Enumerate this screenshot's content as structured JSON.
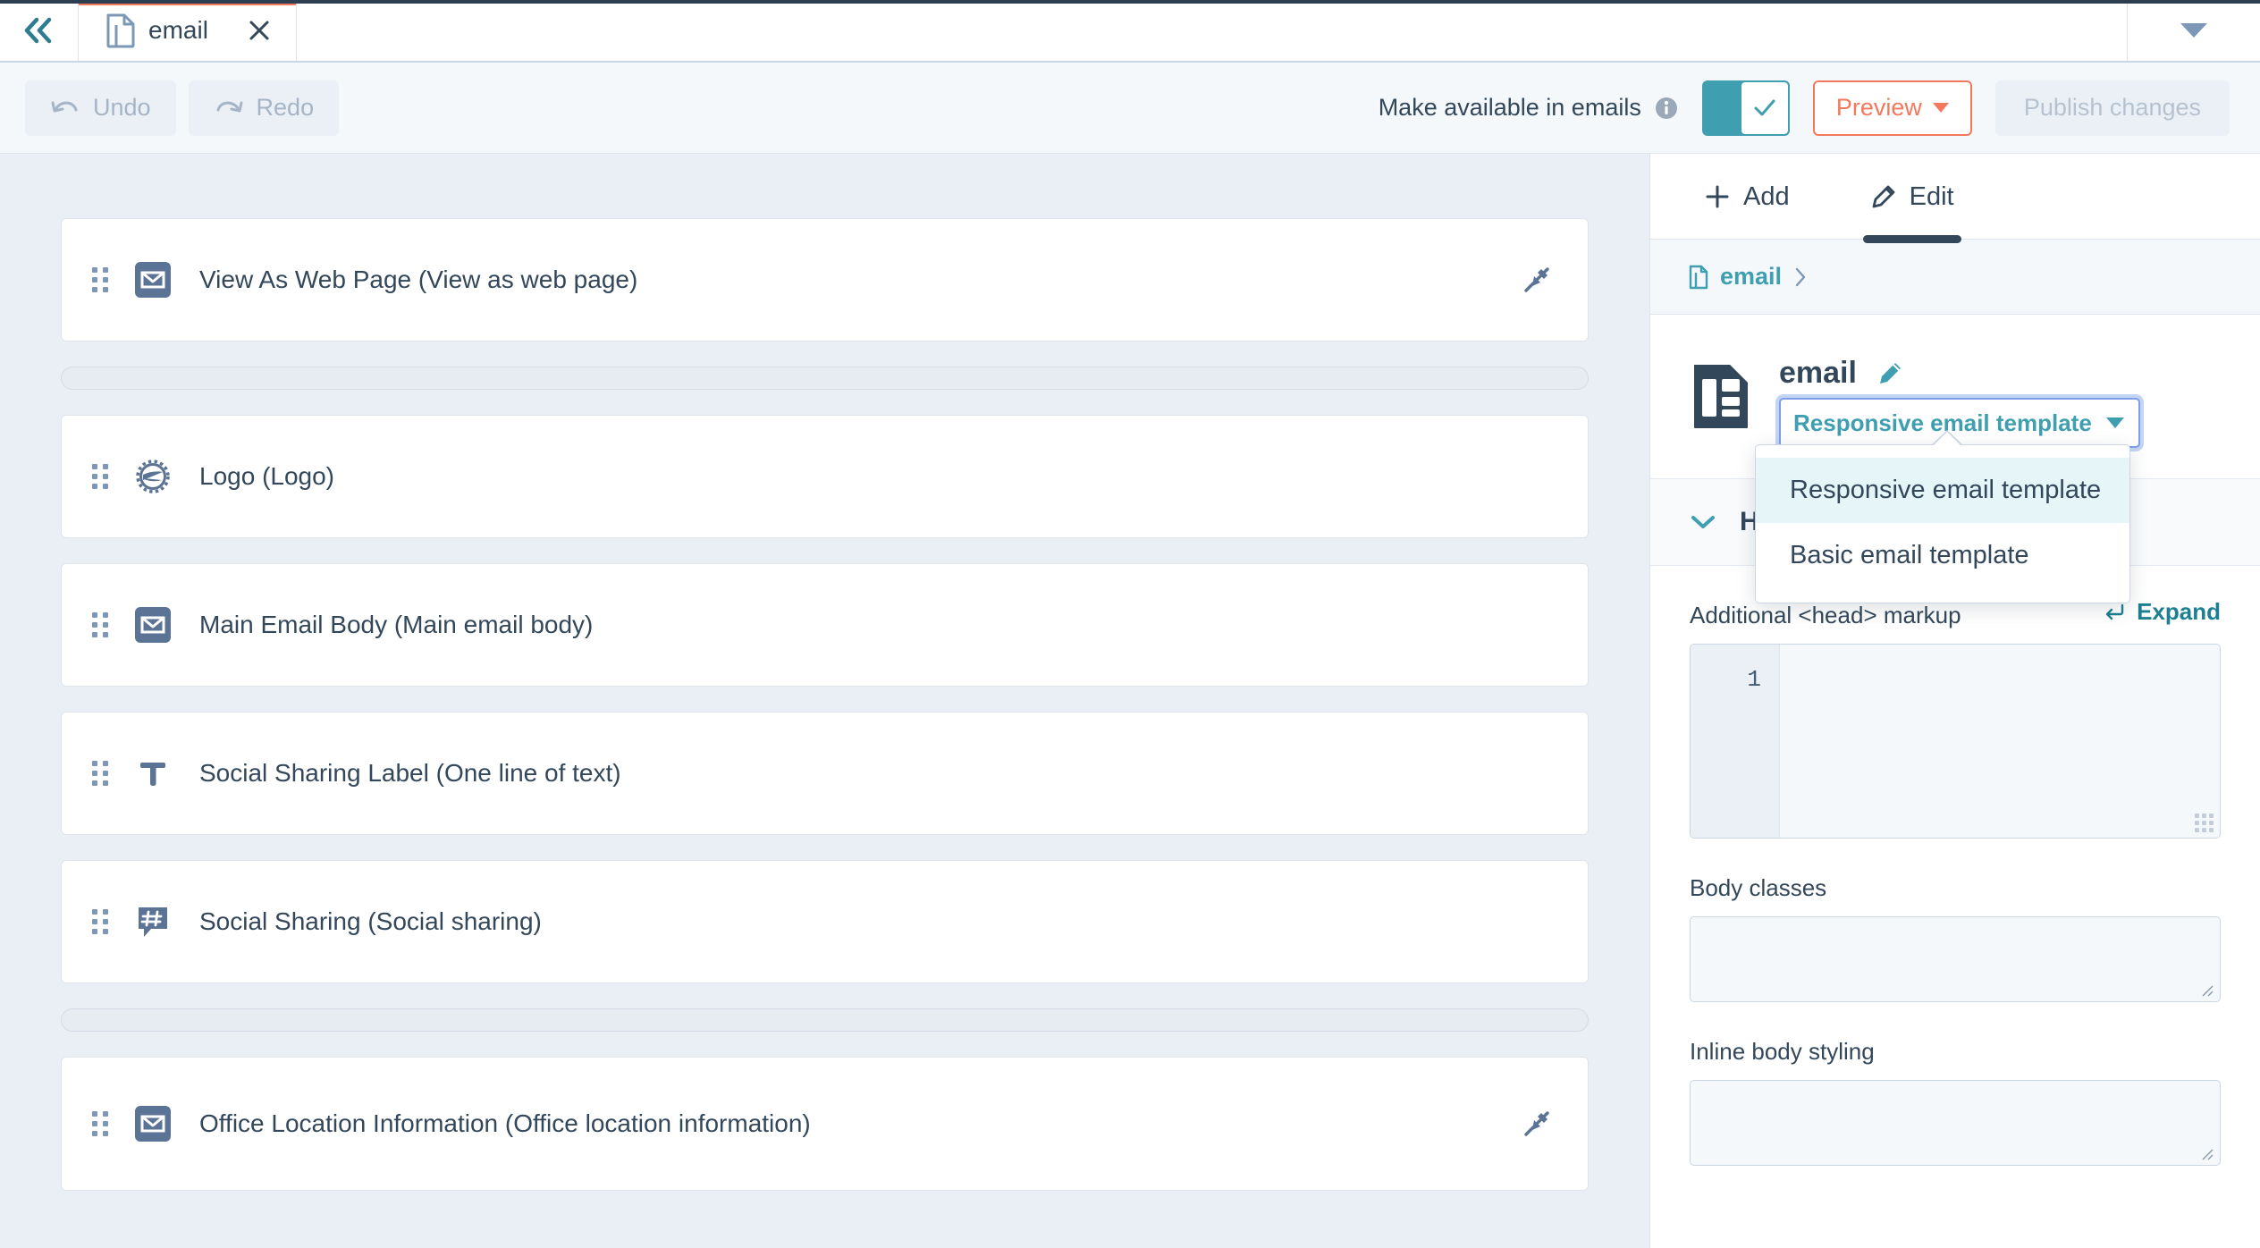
{
  "tabbar": {
    "collapse_label": "collapse-sidebar",
    "tab_title": "email",
    "tab_doc_icon": "document-icon",
    "close_icon": "close-icon",
    "overflow_caret_icon": "chevron-down-icon"
  },
  "toolbar": {
    "undo_label": "Undo",
    "redo_label": "Redo",
    "undo_icon": "undo-arrow-icon",
    "redo_icon": "redo-arrow-icon",
    "available_label": "Make available in emails",
    "info_icon": "info-circle-icon",
    "toggle_state": "on",
    "toggle_check_icon": "check-icon",
    "preview_label": "Preview",
    "publish_label": "Publish changes",
    "accent_orange": "#f2795c",
    "accent_teal": "#3f9fb0"
  },
  "canvas": {
    "modules": [
      {
        "label": "View As Web Page (View as web page)",
        "icon": "envelope-square-icon",
        "locked": true,
        "lock_icon": "pencil-slash-icon",
        "spacer_after": true
      },
      {
        "label": "Logo (Logo)",
        "icon": "logo-badge-icon",
        "locked": false,
        "spacer_after": false
      },
      {
        "label": "Main Email Body (Main email body)",
        "icon": "envelope-square-icon",
        "locked": false,
        "spacer_after": false
      },
      {
        "label": "Social Sharing Label (One line of text)",
        "icon": "text-t-icon",
        "locked": false,
        "spacer_after": false
      },
      {
        "label": "Social Sharing (Social sharing)",
        "icon": "hashtag-bubble-icon",
        "locked": false,
        "spacer_after": true
      },
      {
        "label": "Office Location Information (Office location information)",
        "icon": "envelope-square-icon",
        "locked": true,
        "lock_icon": "pencil-slash-icon",
        "spacer_after": false
      }
    ]
  },
  "panel": {
    "tabs": [
      {
        "label": "Add",
        "icon": "plus-icon",
        "active": false
      },
      {
        "label": "Edit",
        "icon": "pencil-icon",
        "active": true
      }
    ],
    "breadcrumb": {
      "label": "email",
      "doc_icon": "document-icon",
      "chevron_icon": "chevron-right-icon"
    },
    "template": {
      "icon": "email-template-icon",
      "title": "email",
      "rename_icon": "pencil-edit-icon",
      "selected_template": "Responsive email template",
      "select_caret_icon": "caret-down-icon"
    },
    "dropdown": {
      "open": true,
      "options": [
        {
          "label": "Responsive email template",
          "selected": true
        },
        {
          "label": "Basic email template",
          "selected": false
        }
      ]
    },
    "section": {
      "title": "Head",
      "chevron_icon": "chevron-down-icon",
      "expanded": true
    },
    "fields": [
      {
        "label": "Additional <head> markup",
        "expand_label": "Expand",
        "expand_icon": "expand-editor-icon",
        "type": "code",
        "line_number": "1",
        "value": ""
      },
      {
        "label": "Body classes",
        "type": "textarea",
        "value": ""
      },
      {
        "label": "Inline body styling",
        "type": "textarea",
        "value": ""
      }
    ]
  }
}
